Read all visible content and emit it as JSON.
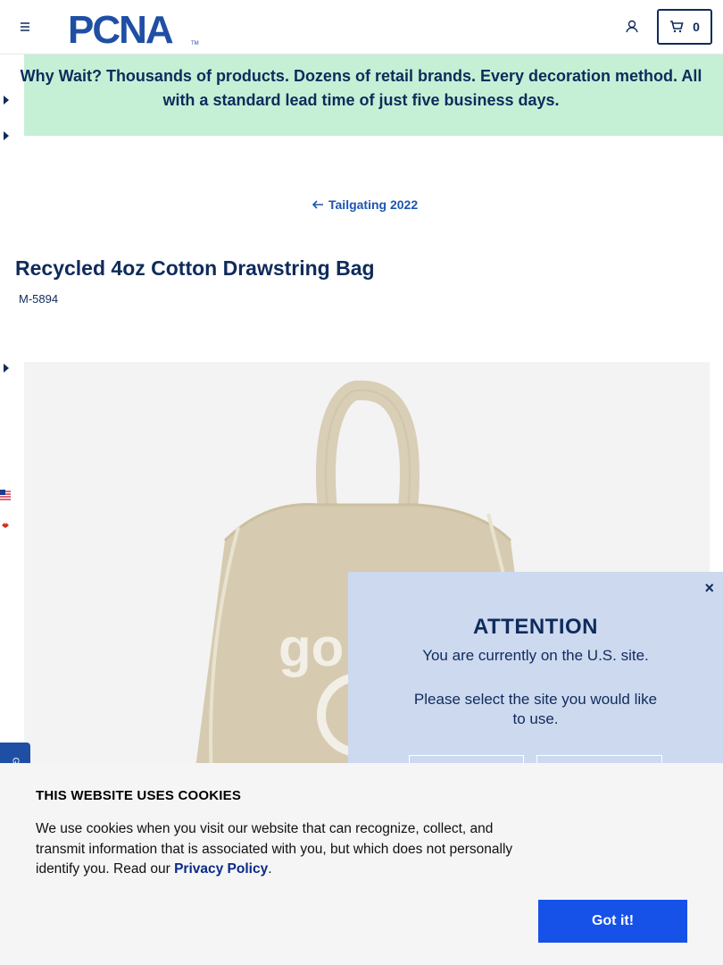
{
  "header": {
    "logo_text": "PCNA",
    "cart_count": "0"
  },
  "promo": {
    "line1": "Why Wait? Thousands of products. Dozens of retail brands. Every decoration method. All",
    "line2": "with a standard lead time of just five business days."
  },
  "breadcrumb": {
    "back_label": "Tailgating 2022"
  },
  "product": {
    "title": "Recycled 4oz Cotton Drawstring Bag",
    "sku": "M-5894"
  },
  "modal": {
    "close_label": "×",
    "title": "ATTENTION",
    "text1": "You are currently on the U.S. site.",
    "text2": "Please select the site you would like to use."
  },
  "cookie": {
    "title": "THIS WEBSITE USES COOKIES",
    "text_before": "We use cookies when you visit our website that can recognize, collect, and transmit information that is associated with you, but which does not personally identify you. Read our ",
    "link_label": "Privacy Policy",
    "text_after": ".",
    "button_label": "Got it!"
  },
  "feedback": {
    "label": "G"
  },
  "colors": {
    "navy": "#0f2b5b",
    "promo_bg": "#c5f0d6",
    "link_blue": "#1f55b0",
    "modal_bg": "#cdd9ef",
    "button_blue": "#1651e8"
  }
}
